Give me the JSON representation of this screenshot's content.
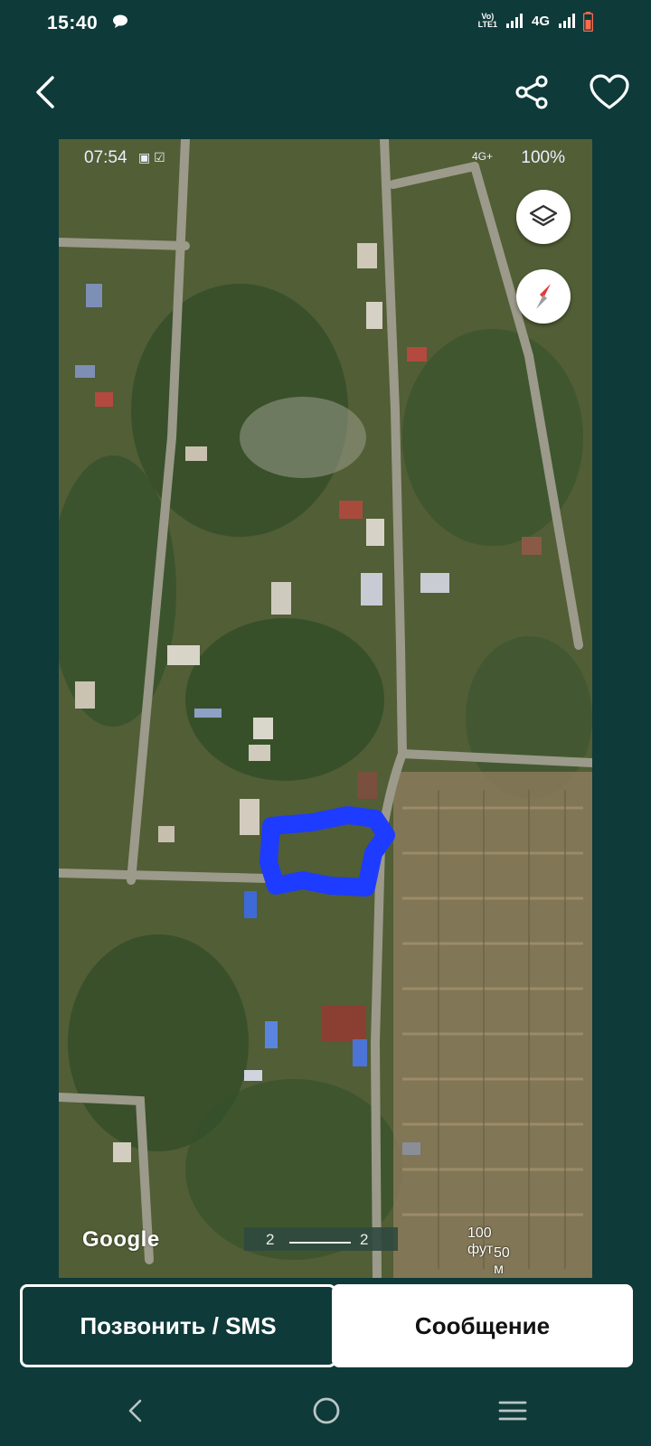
{
  "status_bar": {
    "time": "15:40",
    "network": "4G",
    "volte": "Vo) LTE1",
    "icons": [
      "message-icon",
      "signal-icon",
      "battery-icon"
    ]
  },
  "header": {
    "icons": [
      "back-arrow-icon",
      "share-icon",
      "heart-icon"
    ]
  },
  "map_screenshot": {
    "inner_time": "07:54",
    "inner_battery": "100%",
    "inner_network": "4G+",
    "google_label": "Google",
    "scale_feet": "100 фут",
    "scale_meters": "50 м",
    "scale_left": "2",
    "scale_right": "2",
    "highlight_color": "#1e3cff",
    "controls": [
      "layers-icon",
      "compass-icon"
    ]
  },
  "actions": {
    "call_label": "Позвонить / SMS",
    "message_label": "Сообщение"
  },
  "nav_bar": {
    "icons": [
      "nav-back-icon",
      "nav-home-icon",
      "nav-recent-icon"
    ]
  },
  "colors": {
    "background": "#0e3a39",
    "button_border": "#ffffff",
    "accent_button_bg": "#ffffff"
  }
}
